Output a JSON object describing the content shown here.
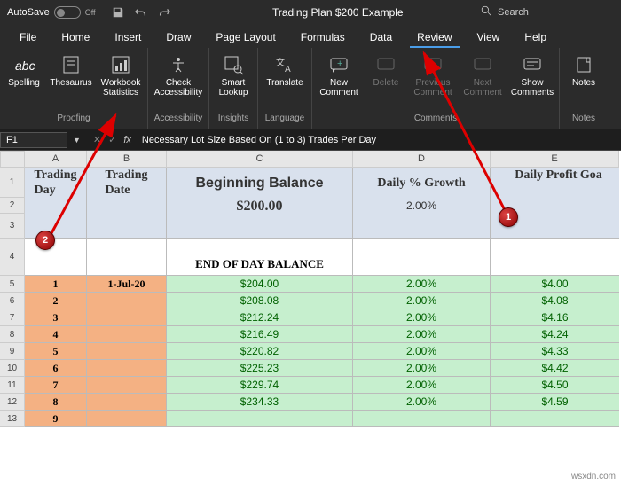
{
  "titlebar": {
    "autosave": "AutoSave",
    "toggle_state": "Off",
    "doc_title": "Trading Plan $200 Example",
    "search_placeholder": "Search"
  },
  "tabs": [
    "File",
    "Home",
    "Insert",
    "Draw",
    "Page Layout",
    "Formulas",
    "Data",
    "Review",
    "View",
    "Help"
  ],
  "active_tab": "Review",
  "ribbon": {
    "proofing": {
      "title": "Proofing",
      "spelling": "Spelling",
      "thesaurus": "Thesaurus",
      "workbook_stats": "Workbook\nStatistics"
    },
    "accessibility": {
      "title": "Accessibility",
      "check": "Check\nAccessibility"
    },
    "insights": {
      "title": "Insights",
      "smart": "Smart\nLookup"
    },
    "language": {
      "title": "Language",
      "translate": "Translate"
    },
    "comments": {
      "title": "Comments",
      "new": "New\nComment",
      "delete": "Delete",
      "previous": "Previous\nComment",
      "next": "Next\nComment",
      "show": "Show\nComments"
    },
    "notes": {
      "title": "Notes",
      "notes": "Notes"
    }
  },
  "namebox": "F1",
  "formula": "Necessary Lot Size Based On (1 to 3) Trades Per Day",
  "columns": [
    "A",
    "B",
    "C",
    "D",
    "E"
  ],
  "header_row": {
    "A": "Trading\nDay",
    "B": "Trading\nDate",
    "C": "Beginning Balance",
    "C2": "$200.00",
    "D": "Daily % Growth",
    "D2": "2.00%",
    "E": "Daily Profit Goa"
  },
  "row4_label": "END OF DAY BALANCE",
  "chart_data": {
    "type": "table",
    "columns": [
      "Trading Day",
      "Trading Date",
      "End of Day Balance",
      "Daily % Growth",
      "Daily Profit Goal"
    ],
    "rows": [
      [
        1,
        "1-Jul-20",
        "$204.00",
        "2.00%",
        "$4.00"
      ],
      [
        2,
        "",
        "$208.08",
        "2.00%",
        "$4.08"
      ],
      [
        3,
        "",
        "$212.24",
        "2.00%",
        "$4.16"
      ],
      [
        4,
        "",
        "$216.49",
        "2.00%",
        "$4.24"
      ],
      [
        5,
        "",
        "$220.82",
        "2.00%",
        "$4.33"
      ],
      [
        6,
        "",
        "$225.23",
        "2.00%",
        "$4.42"
      ],
      [
        7,
        "",
        "$229.74",
        "2.00%",
        "$4.50"
      ],
      [
        8,
        "",
        "$234.33",
        "2.00%",
        "$4.59"
      ],
      [
        9,
        "",
        "",
        "",
        ""
      ]
    ]
  },
  "rownums": [
    "1",
    "2",
    "3",
    "4",
    "5",
    "6",
    "7",
    "8",
    "9",
    "10",
    "11",
    "12",
    "13"
  ],
  "badges": {
    "b1": "1",
    "b2": "2"
  },
  "watermark": "wsxdn.com"
}
